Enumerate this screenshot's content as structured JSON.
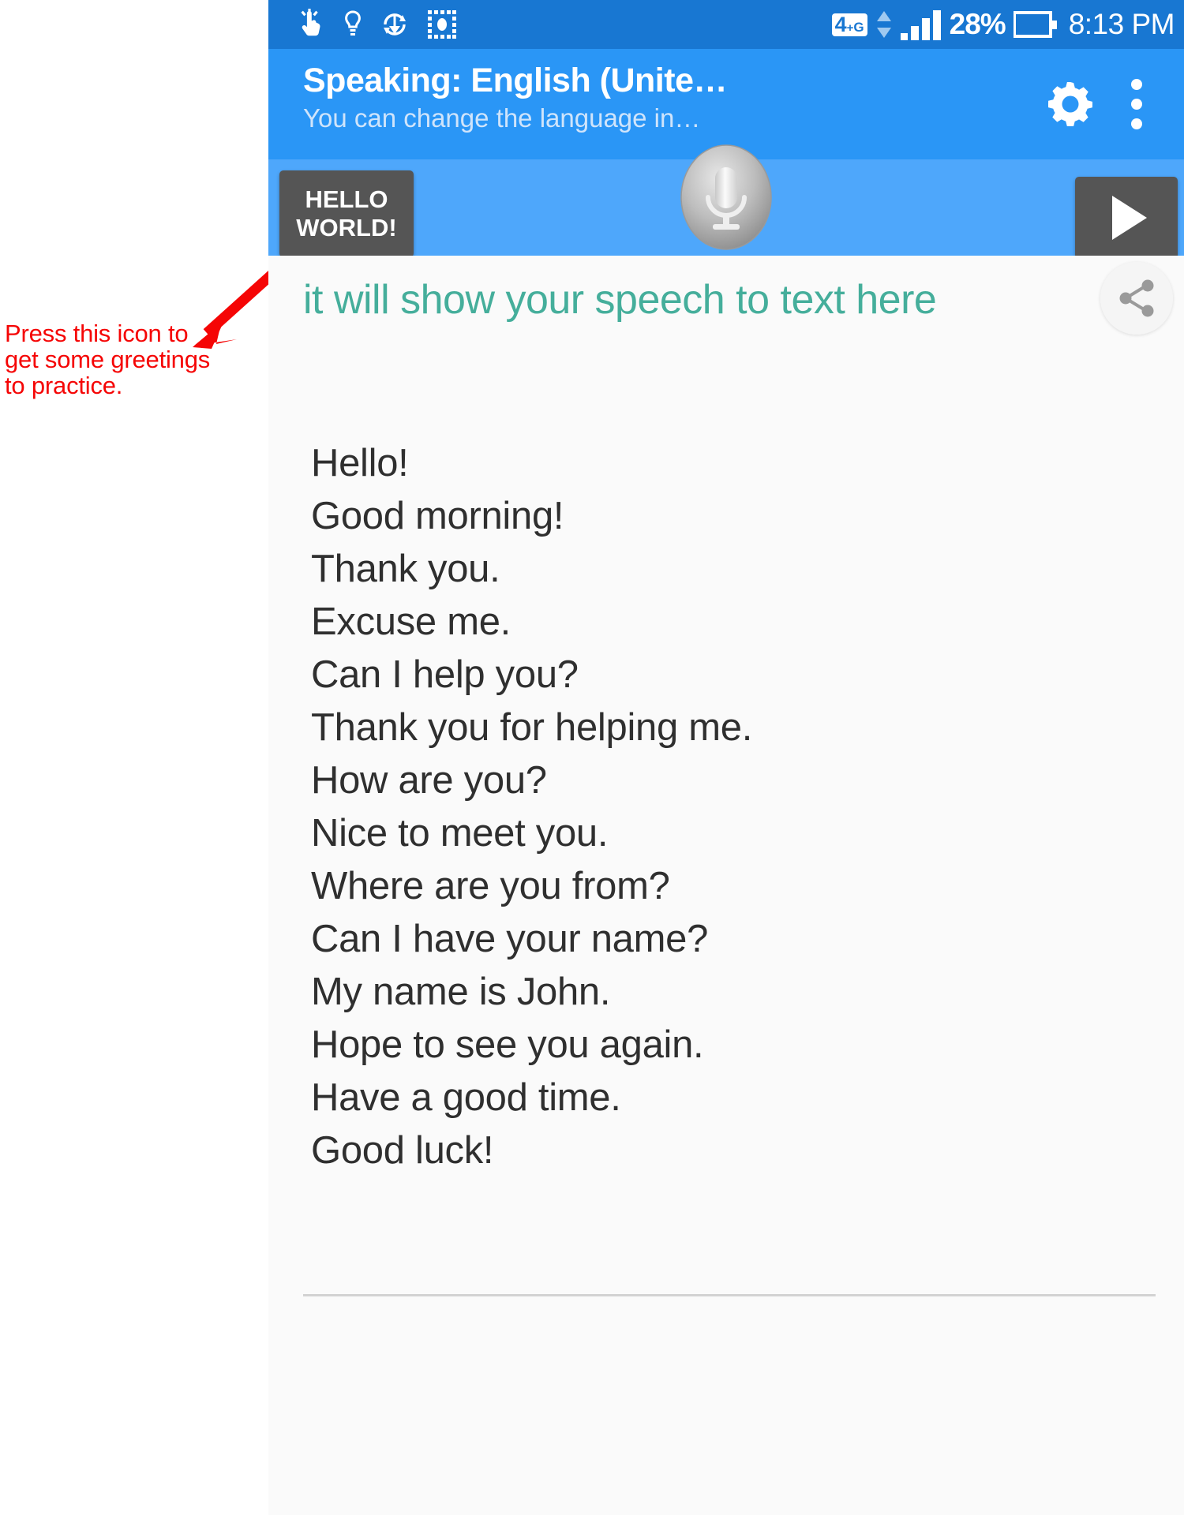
{
  "annotation": {
    "text": "Press this icon to\nget some greetings\nto practice.",
    "color": "#f50505",
    "arrow_name": "red-arrow-pointing-to-hello-world-button"
  },
  "status_bar": {
    "background": "#1877d2",
    "icons": [
      "touch-gesture-icon",
      "lightbulb-icon",
      "sync-download-icon",
      "screenshot-capture-icon"
    ],
    "network_label_main": "4",
    "network_label_sup": "+",
    "network_label_sub": "G",
    "data_arrows": "up-down-data-icon",
    "signal": "signal-bars-icon",
    "battery_percent": "28%",
    "battery_icon": "battery-icon",
    "clock": "8:13 PM"
  },
  "app_bar": {
    "background": "#2a96f6",
    "title": "Speaking: English (Unite…)",
    "title_display": "Speaking: English (Unite…",
    "subtitle": "You can change the language in…",
    "settings_label": "gear-icon",
    "overflow_label": "more-options-icon"
  },
  "controls": {
    "background": "#4ea7fb",
    "hello_world_label": "HELLO\nWORLD!",
    "mic_label": "microphone-button",
    "play_label": "play-button"
  },
  "content": {
    "speech_hint": "it will show your speech to text here",
    "speech_hint_color": "#45ae9b",
    "share_label": "share-icon",
    "greetings": [
      "Hello!",
      "Good morning!",
      "Thank you.",
      "Excuse me.",
      "Can I help you?",
      "Thank you for helping me.",
      "How are you?",
      "Nice to meet you.",
      "Where are you from?",
      "Can I have your name?",
      "My name is John.",
      "Hope to see you again.",
      "Have a good time.",
      "Good luck!"
    ]
  }
}
